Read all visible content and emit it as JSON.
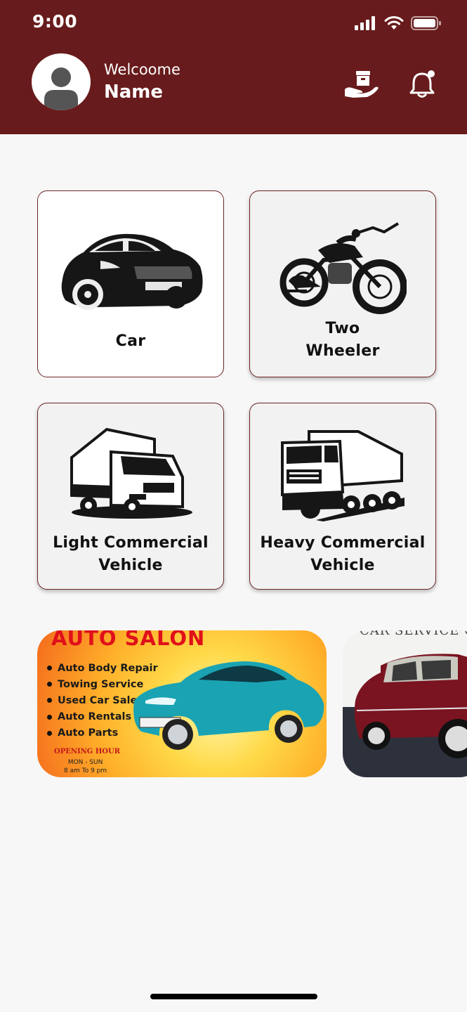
{
  "status_bar": {
    "time": "9:00"
  },
  "header": {
    "greeting": "Welcoome",
    "user_name": "Name",
    "colors": {
      "background": "#681b1c",
      "text": "#ffffff"
    }
  },
  "categories": [
    {
      "label": "Car",
      "icon": "car-icon"
    },
    {
      "label": "Two\nWheeler",
      "icon": "motorcycle-icon"
    },
    {
      "label": "Light Commercial\nVehicle",
      "icon": "light-truck-icon"
    },
    {
      "label": "Heavy Commercial\nVehicle",
      "icon": "dump-truck-icon"
    }
  ],
  "banners": [
    {
      "title": "AUTO SALON",
      "services": [
        "Auto Body Repair",
        "Towing Service",
        "Used Car Sale",
        "Auto Rentals",
        "Auto Parts"
      ],
      "hours_label": "OPENING HOUR",
      "days": "MON - SUN",
      "hours": "8 am To 9 pm"
    },
    {
      "title": "CAR SERVICE CEN"
    }
  ]
}
